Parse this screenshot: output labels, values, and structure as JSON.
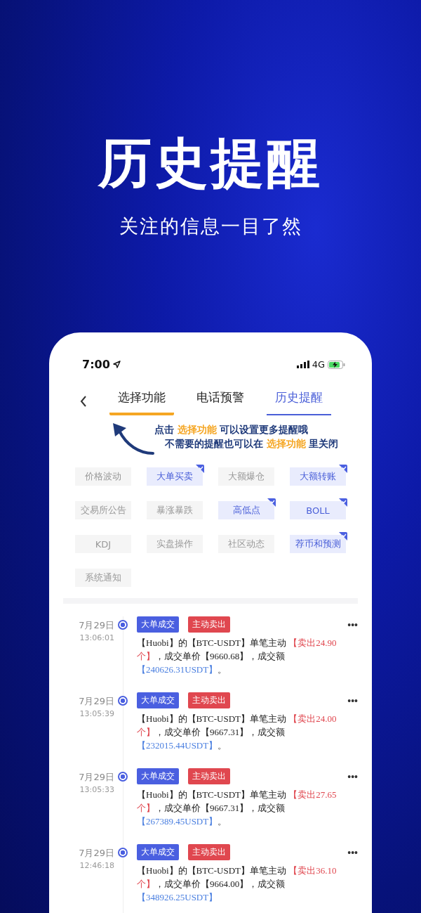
{
  "headline": "历史提醒",
  "subtitle": "关注的信息一目了然",
  "status_bar": {
    "time": "7:00",
    "network": "4G"
  },
  "tabs": [
    {
      "label": "选择功能",
      "selected": false,
      "highlighted": true
    },
    {
      "label": "电话预警",
      "selected": false,
      "highlighted": false
    },
    {
      "label": "历史提醒",
      "selected": true,
      "highlighted": false
    }
  ],
  "hint_lines": [
    [
      {
        "kind": "plain",
        "text": "点击 "
      },
      {
        "kind": "highlight",
        "text": "选择功能"
      },
      {
        "kind": "plain",
        "text": " 可以设置更多提醒哦"
      }
    ],
    [
      {
        "kind": "plain",
        "text": "不需要的提醒也可以在 "
      },
      {
        "kind": "highlight",
        "text": "选择功能"
      },
      {
        "kind": "plain",
        "text": " 里关闭"
      }
    ]
  ],
  "filters": [
    {
      "label": "价格波动",
      "checked": false
    },
    {
      "label": "大单买卖",
      "checked": true
    },
    {
      "label": "大额爆仓",
      "checked": false
    },
    {
      "label": "大额转账",
      "checked": true
    },
    {
      "label": "交易所公告",
      "checked": false
    },
    {
      "label": "暴涨暴跌",
      "checked": false
    },
    {
      "label": "高低点",
      "checked": true
    },
    {
      "label": "BOLL",
      "checked": true
    },
    {
      "label": "KDJ",
      "checked": false
    },
    {
      "label": "实盘操作",
      "checked": false
    },
    {
      "label": "社区动态",
      "checked": false
    },
    {
      "label": "荐币和预测",
      "checked": true
    },
    {
      "label": "系统通知",
      "checked": false
    }
  ],
  "alerts": [
    {
      "date": "7月29日",
      "time": "13:06:01",
      "tags": [
        {
          "label": "大单成交",
          "kind": "type"
        },
        {
          "label": "主动卖出",
          "kind": "side"
        }
      ],
      "more": "•••",
      "message": [
        {
          "kind": "plain",
          "text": "【Huobi】的【BTC-USDT】单笔主动 "
        },
        {
          "kind": "sell",
          "text": "【卖出24.90个】"
        },
        {
          "kind": "plain",
          "text": "，成交单价【9660.68】，成交额"
        },
        {
          "kind": "amount",
          "text": "【240626.31USDT】"
        },
        {
          "kind": "plain",
          "text": "。"
        }
      ]
    },
    {
      "date": "7月29日",
      "time": "13:05:39",
      "tags": [
        {
          "label": "大单成交",
          "kind": "type"
        },
        {
          "label": "主动卖出",
          "kind": "side"
        }
      ],
      "more": "•••",
      "message": [
        {
          "kind": "plain",
          "text": "【Huobi】的【BTC-USDT】单笔主动 "
        },
        {
          "kind": "sell",
          "text": "【卖出24.00个】"
        },
        {
          "kind": "plain",
          "text": "，成交单价【9667.31】，成交额"
        },
        {
          "kind": "amount",
          "text": "【232015.44USDT】"
        },
        {
          "kind": "plain",
          "text": "。"
        }
      ]
    },
    {
      "date": "7月29日",
      "time": "13:05:33",
      "tags": [
        {
          "label": "大单成交",
          "kind": "type"
        },
        {
          "label": "主动卖出",
          "kind": "side"
        }
      ],
      "more": "•••",
      "message": [
        {
          "kind": "plain",
          "text": "【Huobi】的【BTC-USDT】单笔主动 "
        },
        {
          "kind": "sell",
          "text": "【卖出27.65个】"
        },
        {
          "kind": "plain",
          "text": "，成交单价【9667.31】，成交额"
        },
        {
          "kind": "amount",
          "text": "【267389.45USDT】"
        },
        {
          "kind": "plain",
          "text": "。"
        }
      ]
    },
    {
      "date": "7月29日",
      "time": "12:46:18",
      "tags": [
        {
          "label": "大单成交",
          "kind": "type"
        },
        {
          "label": "主动卖出",
          "kind": "side"
        }
      ],
      "more": "•••",
      "message": [
        {
          "kind": "plain",
          "text": "【Huobi】的【BTC-USDT】单笔主动 "
        },
        {
          "kind": "sell",
          "text": "【卖出36.10个】"
        },
        {
          "kind": "plain",
          "text": "，成交单价【9664.00】，成交额"
        },
        {
          "kind": "amount",
          "text": "【348926.25USDT】"
        }
      ]
    }
  ]
}
